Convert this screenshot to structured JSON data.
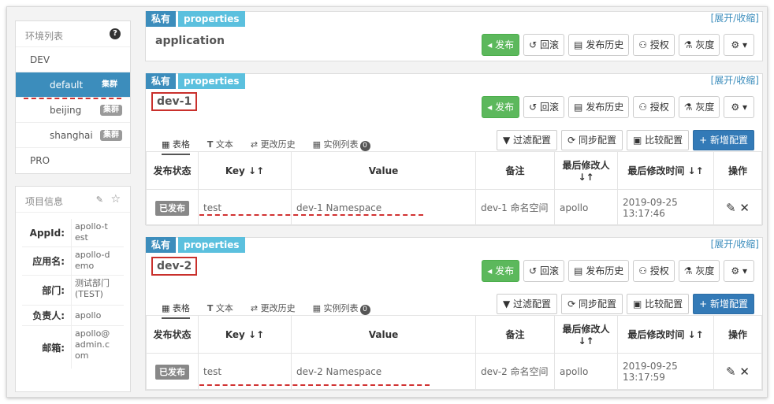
{
  "env_panel": {
    "header": "环境列表",
    "items": [
      {
        "label": "DEV",
        "badge": ""
      },
      {
        "label": "default",
        "badge": "集群"
      },
      {
        "label": "beijing",
        "badge": "集群"
      },
      {
        "label": "shanghai",
        "badge": "集群"
      },
      {
        "label": "PRO",
        "badge": ""
      }
    ]
  },
  "project_panel": {
    "header": "项目信息",
    "rows": [
      {
        "key": "AppId:",
        "value": "apollo-test"
      },
      {
        "key": "应用名:",
        "value": "apollo-demo"
      },
      {
        "key": "部门:",
        "value": "测试部门(TEST)"
      },
      {
        "key": "负责人:",
        "value": "apollo"
      },
      {
        "key": "邮箱:",
        "value": "apollo@admin.com"
      }
    ]
  },
  "namespace_common": {
    "tag_private": "私有",
    "tag_properties": "properties",
    "toggle": "[展开/收缩]",
    "buttons": {
      "publish": "发布",
      "rollback": "回滚",
      "history": "发布历史",
      "auth": "授权",
      "gray": "灰度",
      "gear": "⚙ ▾"
    },
    "tabs": {
      "table": "表格",
      "text": "文本",
      "history": "更改历史",
      "instances": "实例列表",
      "instance_count": "0"
    },
    "tools": {
      "filter": "过滤配置",
      "sync": "同步配置",
      "compare": "比较配置",
      "add": "+ 新增配置"
    },
    "columns": {
      "status": "发布状态",
      "key": "Key ↓↑",
      "value": "Value",
      "comment": "备注",
      "modifier": "最后修改人 ↓↑",
      "modified": "最后修改时间 ↓↑",
      "ops": "操作"
    }
  },
  "namespaces": [
    {
      "title": "application"
    },
    {
      "title": "dev-1",
      "row": {
        "status": "已发布",
        "key": "test",
        "value": "dev-1 Namespace",
        "comment": "dev-1 命名空间",
        "modifier": "apollo",
        "modified": "2019-09-25 13:17:46"
      }
    },
    {
      "title": "dev-2",
      "row": {
        "status": "已发布",
        "key": "test",
        "value": "dev-2 Namespace",
        "comment": "dev-2 命名空间",
        "modifier": "apollo",
        "modified": "2019-09-25 13:17:59"
      }
    }
  ],
  "colors": {
    "primary": "#3c8dbc",
    "success": "#5cb85c",
    "info": "#5bc0de",
    "annotation": "#d13232"
  }
}
